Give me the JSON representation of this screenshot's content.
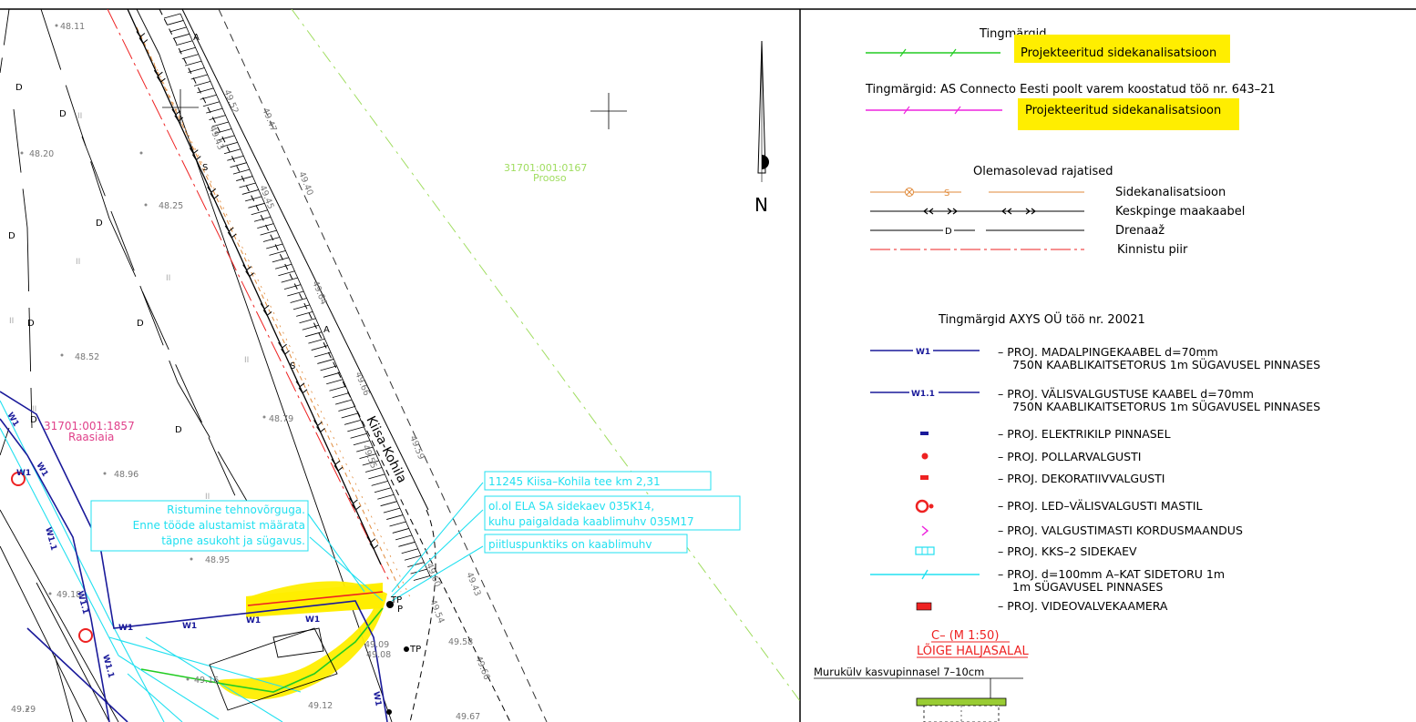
{
  "map": {
    "spot_heights": [
      "48.11",
      "48.20",
      "48.25",
      "48.52",
      "48.79",
      "48.96",
      "48.95",
      "49.18",
      "49.16",
      "49.12",
      "49.29",
      "49.09",
      "49.08",
      "49.52",
      "49.43",
      "49.47",
      "49.40",
      "49.45",
      "49.64",
      "49.66",
      "49.55",
      "49.60",
      "49.54",
      "49.43",
      "49.58",
      "49.66",
      "49.67",
      "49.59",
      "49.6",
      "49.5"
    ],
    "parcel_right": {
      "id": "31701:001:0167",
      "name": "Prooso"
    },
    "parcel_left": {
      "id": "31701:001:1857",
      "name": "Raasiaia"
    },
    "road_name": "Kiisa-Kohila",
    "north_label": "N",
    "callouts": {
      "crossing": [
        "Ristumine tehnovõrguga.",
        "Enne tööde alustamist määrata",
        "täpne asukoht ja sügavus."
      ],
      "road_km": "11245 Kiisa–Kohila tee km 2,31",
      "existing": [
        "ol.ol ELA SA sidekaev 035K14,",
        "kuhu paigaldada kaablimuhv 035M17"
      ],
      "splice": "piitluspunktiks on kaablimuhv"
    },
    "line_codes": {
      "w1": "W1",
      "w11": "W1.1",
      "d": "D",
      "s": "S",
      "a": "A",
      "ii": "II",
      "tp": "TP",
      "p": "P"
    }
  },
  "legend": {
    "title": "Tingmärgid",
    "green_label": "Projekteeritud sidekanalisatsioon",
    "connecto_title": "Tingmärgid: AS Connecto Eesti poolt varem koostatud töö nr. 643–21",
    "magenta_label": "Projekteeritud sidekanalisatsioon",
    "existing_title": "Olemasolevad rajatised",
    "existing": [
      {
        "code": "S",
        "label": "Sidekanalisatsioon"
      },
      {
        "code": "",
        "label": "Keskpinge maakaabel"
      },
      {
        "code": "D",
        "label": "Drenaaž"
      },
      {
        "code": "",
        "label": "Kinnistu piir"
      }
    ],
    "axys_title": "Tingmärgid AXYS OÜ töö nr. 20021",
    "axys": [
      {
        "code": "W1",
        "line1": "– PROJ. MADALPINGEKAABEL d=70mm",
        "line2": "750N KAABLIKAITSETORUS 1m SÜGAVUSEL PINNASES"
      },
      {
        "code": "W1.1",
        "line1": "– PROJ. VÄLISVALGUSTUSE KAABEL d=70mm",
        "line2": "750N KAABLIKAITSETORUS 1m SÜGAVUSEL PINNASES"
      },
      {
        "code": "",
        "line1": "– PROJ. ELEKTRIKILP PINNASEL",
        "line2": ""
      },
      {
        "code": "",
        "line1": "– PROJ. POLLARVALGUSTI",
        "line2": ""
      },
      {
        "code": "",
        "line1": "– PROJ. DEKORATIIVVALGUSTI",
        "line2": ""
      },
      {
        "code": "",
        "line1": "– PROJ. LED–VÄLISVALGUSTI MASTIL",
        "line2": ""
      },
      {
        "code": "",
        "line1": "– PROJ. VALGUSTIMASTI KORDUSMAANDUS",
        "line2": ""
      },
      {
        "code": "",
        "line1": "– PROJ. KKS–2 SIDEKAEV",
        "line2": ""
      },
      {
        "code": "",
        "line1": "– PROJ. d=100mm A–KAT SIDETORU 1m",
        "line2": "1m SÜGAVUSEL PINNASES"
      },
      {
        "code": "",
        "line1": "– PROJ. VIDEOVALVEKAAMERA",
        "line2": ""
      }
    ],
    "section_title": "C– (M 1:50)",
    "section_subtitle": "LÕIGE HALJASALAL",
    "section_note": "Murukülv kasvupinnasel 7–10cm"
  },
  "colors": {
    "green": "#22cc22",
    "magenta": "#ee22dd",
    "orange": "#e08a3a",
    "navy": "#1a1a9a",
    "cyan": "#22e0f0",
    "red": "#ee2222",
    "highlight": "#ffee00",
    "pink": "#e0408a",
    "lightgreen": "#a0dd60",
    "grass": "#99cc33"
  }
}
